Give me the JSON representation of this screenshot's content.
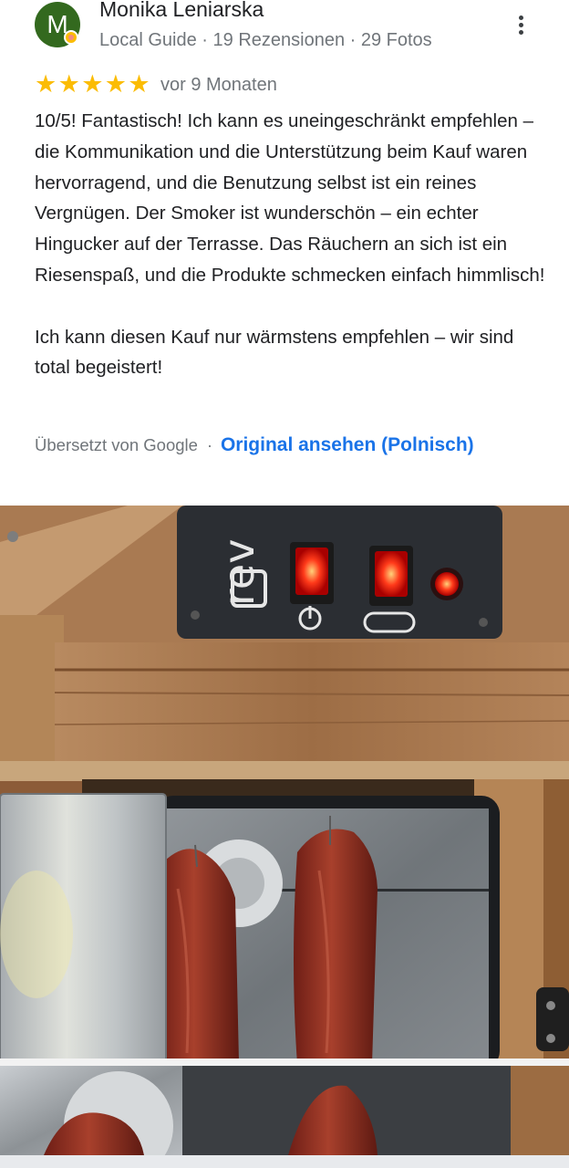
{
  "review": {
    "author": {
      "avatar_letter": "M",
      "name": "Monika Leniarska",
      "meta": "Local Guide · 19 Rezensionen · 29 Fotos"
    },
    "rating": {
      "stars": 5,
      "date": "vor 9 Monaten"
    },
    "paragraphs": [
      "10/5! Fantastisch! Ich kann es uneingeschränkt empfehlen – die Kommunikation und die Unterstützung beim Kauf waren hervorragend, und die Benutzung selbst ist ein reines Vergnügen. Der Smoker ist wunderschön – ein echter Hingucker auf der Terrasse. Das Räuchern an sich ist ein Riesenspaß, und die Produkte schmecken einfach himmlisch!",
      "Ich kann diesen Kauf nur wärmstens empfehlen – wir sind total begeistert!"
    ],
    "translation": {
      "label": "Übersetzt von Google",
      "separator": "·",
      "link": "Original ansehen (Polnisch)"
    }
  },
  "photo": {
    "panel_brand_text": "rev"
  },
  "colors": {
    "avatar": "#33691e",
    "star": "#fbbc04",
    "link": "#1a73e8",
    "text": "#202124",
    "muted": "#70757a"
  },
  "icons": {
    "more": "more-vert-icon",
    "star": "star-icon",
    "power": "power-icon"
  }
}
